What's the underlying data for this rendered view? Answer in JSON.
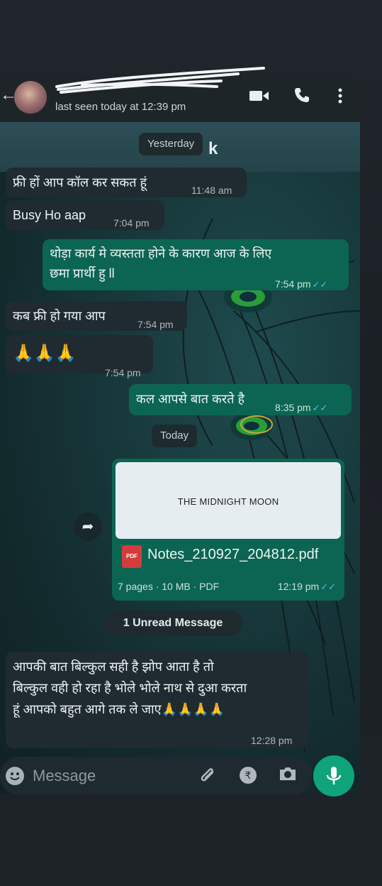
{
  "header": {
    "last_seen": "last seen today at 12:39 pm"
  },
  "wallpaper_banner_text": "k",
  "date_chips": {
    "yesterday": "Yesterday",
    "today": "Today"
  },
  "messages": [
    {
      "dir": "in",
      "text": "फ्री हों आप कॉल कर सकत हूं",
      "time": "11:48 am"
    },
    {
      "dir": "in",
      "text": "Busy Ho aap",
      "time": "7:04 pm"
    },
    {
      "dir": "out",
      "line1": "थोड़ा कार्य मे व्यस्तता होने के कारण आज के लिए",
      "line2": "छमा प्रार्थी हु ll",
      "time": "7:54 pm"
    },
    {
      "dir": "in",
      "text": "कब फ्री हो गया आप",
      "time": "7:54 pm"
    },
    {
      "dir": "in",
      "text": "🙏🙏🙏",
      "time": "7:54 pm"
    },
    {
      "dir": "out",
      "text": "कल आपसे बात करते है",
      "time": "8:35 pm"
    }
  ],
  "document": {
    "preview_text": "THE MIDNIGHT MOON",
    "badge": "PDF",
    "file_name": "Notes_210927_204812.pdf",
    "meta": "7 pages · 10 MB · PDF",
    "time": "12:19 pm"
  },
  "unread_label": "1 Unread Message",
  "last_message": {
    "line1": "आपकी बात बिल्कुल सही है झोप आता है तो",
    "line2": "बिल्कुल वही हो रहा है भोले भोले नाथ से दुआ करता",
    "line3": "हूं आपको बहुत आगे तक ले जाए🙏🙏🙏🙏",
    "time": "12:28 pm"
  },
  "input": {
    "placeholder": "Message"
  },
  "icons": {
    "back": "arrow-left-icon",
    "video": "video-call-icon",
    "call": "phone-icon",
    "menu": "more-vert-icon",
    "forward": "forward-icon",
    "emoji": "emoji-icon",
    "attach": "paperclip-icon",
    "payment": "rupee-icon",
    "camera": "camera-icon",
    "mic": "mic-icon"
  },
  "colors": {
    "outgoing_bubble": "#0b6552",
    "incoming_bubble": "#1f2b30",
    "read_ticks": "#53bdeb",
    "mic_button": "#0fa47a"
  }
}
